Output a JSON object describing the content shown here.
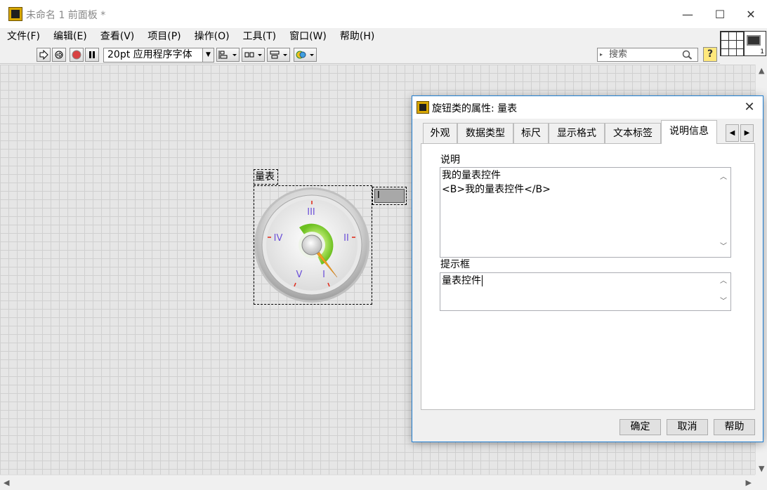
{
  "window": {
    "title": "未命名 1 前面板 *",
    "minimize": "—",
    "maximize": "☐",
    "close": "✕"
  },
  "menu": [
    "文件(F)",
    "编辑(E)",
    "查看(V)",
    "项目(P)",
    "操作(O)",
    "工具(T)",
    "窗口(W)",
    "帮助(H)"
  ],
  "toolbar": {
    "font_select": "20pt 应用程序字体",
    "search_placeholder": "搜索",
    "help_label": "?"
  },
  "vi_icon": {
    "terminal_number": "1"
  },
  "gauge": {
    "label": "量表",
    "scale_labels": [
      "I",
      "II",
      "III",
      "IV",
      "V"
    ],
    "digital_value": "I",
    "colors": {
      "scale_text": "#6b4fd8",
      "ticks": "#e03020",
      "needle": "#f0a020",
      "arc": "#8ed43a"
    }
  },
  "dialog": {
    "title": "旋钮类的属性: 量表",
    "tabs": [
      "外观",
      "数据类型",
      "标尺",
      "显示格式",
      "文本标签",
      "说明信息"
    ],
    "active_tab": "说明信息",
    "description_label": "说明",
    "description_lines": [
      "我的量表控件",
      "<B>我的量表控件</B>"
    ],
    "tip_label": "提示框",
    "tip_text": "量表控件",
    "buttons": {
      "ok": "确定",
      "cancel": "取消",
      "help": "帮助"
    }
  }
}
